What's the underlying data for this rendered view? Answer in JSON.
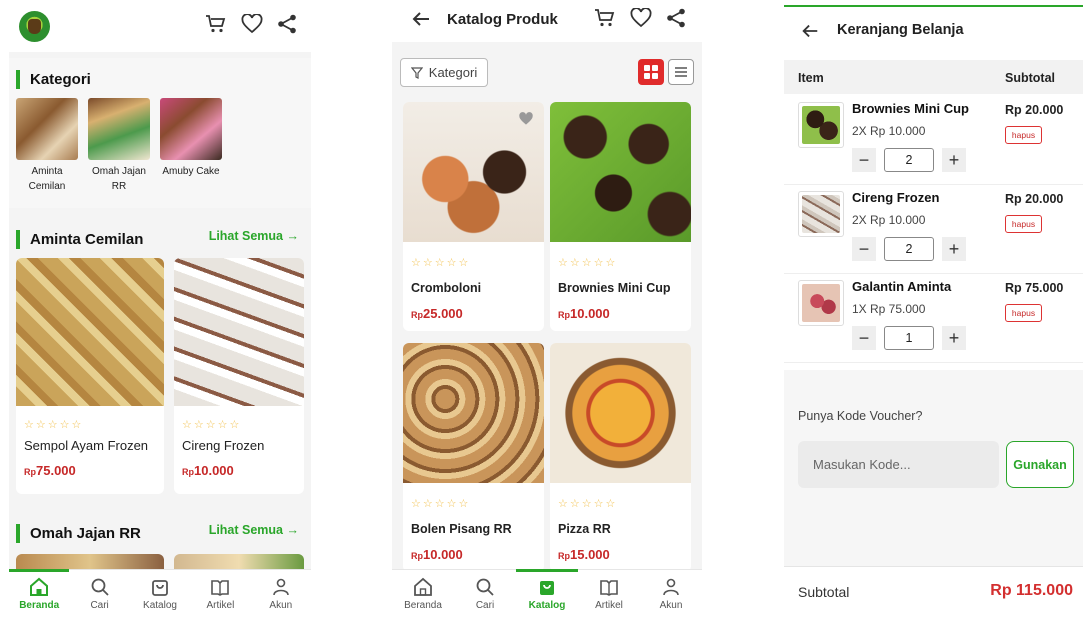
{
  "colors": {
    "accent": "#2aa62a",
    "price": "#c62828",
    "alert": "#e02b2b"
  },
  "home": {
    "icons": [
      "cart-icon",
      "heart-icon",
      "share-icon"
    ],
    "kategori_title": "Kategori",
    "categories": [
      {
        "label": "Aminta Cemilan"
      },
      {
        "label": "Omah Jajan RR"
      },
      {
        "label": "Amuby Cake"
      }
    ],
    "section1": {
      "title": "Aminta Cemilan",
      "see_all": "Lihat Semua",
      "products": [
        {
          "stars": "☆☆☆☆☆",
          "name": "Sempol Ayam Frozen",
          "currency": "Rp",
          "price": "75.000"
        },
        {
          "stars": "☆☆☆☆☆",
          "name": "Cireng Frozen",
          "currency": "Rp",
          "price": "10.000"
        }
      ]
    },
    "section2": {
      "title": "Omah Jajan RR",
      "see_all": "Lihat Semua"
    },
    "nav": [
      {
        "label": "Beranda",
        "icon": "home-icon",
        "active": true
      },
      {
        "label": "Cari",
        "icon": "search-icon"
      },
      {
        "label": "Katalog",
        "icon": "bag-icon"
      },
      {
        "label": "Artikel",
        "icon": "book-icon"
      },
      {
        "label": "Akun",
        "icon": "user-icon"
      }
    ]
  },
  "catalog": {
    "title": "Katalog Produk",
    "filter_label": "Kategori",
    "products": [
      {
        "stars": "☆☆☆☆☆",
        "name": "Cromboloni",
        "currency": "Rp",
        "price": "25.000"
      },
      {
        "stars": "☆☆☆☆☆",
        "name": "Brownies Mini Cup",
        "currency": "Rp",
        "price": "10.000"
      },
      {
        "stars": "☆☆☆☆☆",
        "name": "Bolen Pisang RR",
        "currency": "Rp",
        "price": "10.000"
      },
      {
        "stars": "☆☆☆☆☆",
        "name": "Pizza RR",
        "currency": "Rp",
        "price": "15.000"
      }
    ],
    "nav": [
      {
        "label": "Beranda",
        "icon": "home-icon"
      },
      {
        "label": "Cari",
        "icon": "search-icon"
      },
      {
        "label": "Katalog",
        "icon": "bag-icon",
        "active": true
      },
      {
        "label": "Artikel",
        "icon": "book-icon"
      },
      {
        "label": "Akun",
        "icon": "user-icon"
      }
    ]
  },
  "cart": {
    "title": "Keranjang Belanja",
    "col_item": "Item",
    "col_subtotal": "Subtotal",
    "items": [
      {
        "name": "Brownies Mini Cup",
        "qty_line": "2X Rp 10.000",
        "subtotal": "Rp 20.000",
        "remove": "hapus",
        "qty": "2"
      },
      {
        "name": "Cireng Frozen",
        "qty_line": "2X Rp 10.000",
        "subtotal": "Rp 20.000",
        "remove": "hapus",
        "qty": "2"
      },
      {
        "name": "Galantin Aminta",
        "qty_line": "1X Rp 75.000",
        "subtotal": "Rp 75.000",
        "remove": "hapus",
        "qty": "1"
      }
    ],
    "voucher_label": "Punya Kode Voucher?",
    "voucher_placeholder": "Masukan Kode...",
    "voucher_button": "Gunakan",
    "subtotal_label": "Subtotal",
    "subtotal_value": "Rp 115.000"
  }
}
